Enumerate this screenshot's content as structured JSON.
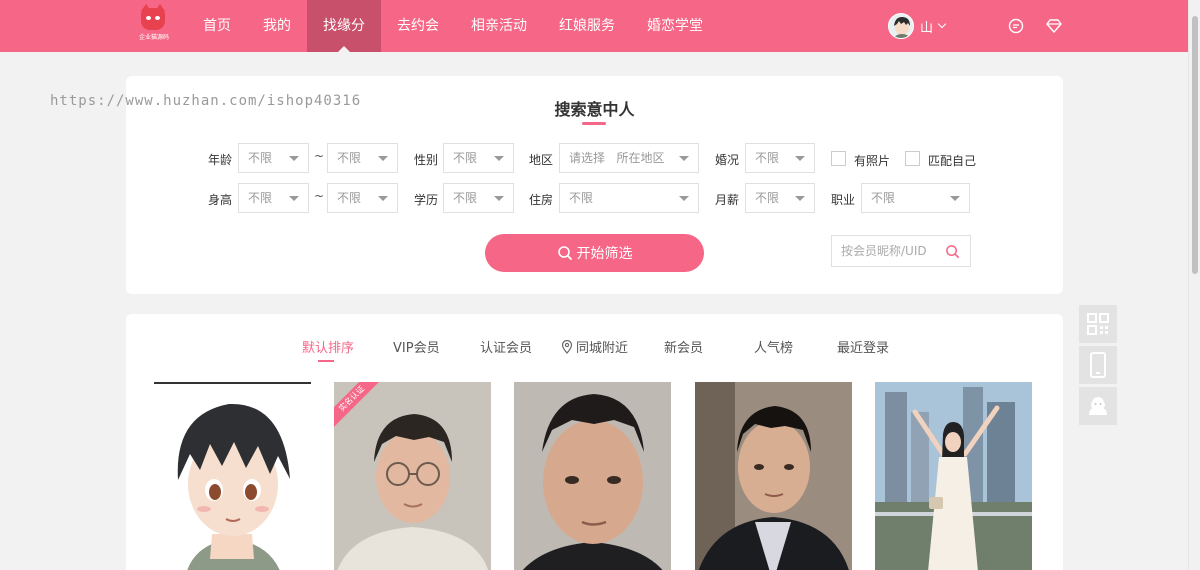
{
  "header": {
    "logo_text": "企业猫源码",
    "nav": [
      {
        "label": "首页"
      },
      {
        "label": "我的"
      },
      {
        "label": "找缘分",
        "active": true
      },
      {
        "label": "去约会"
      },
      {
        "label": "相亲活动"
      },
      {
        "label": "红娘服务"
      },
      {
        "label": "婚恋学堂"
      }
    ],
    "user_name": "山",
    "icons": [
      "chat-icon",
      "diamond-icon"
    ],
    "accent_color": "#f66787"
  },
  "watermark": "https://www.huzhan.com/ishop40316",
  "search": {
    "title": "搜索意中人",
    "row1": {
      "age_label": "年龄",
      "age_from": "不限",
      "tilde": "~",
      "age_to": "不限",
      "gender_label": "性别",
      "gender": "不限",
      "region_label": "地区",
      "region": "请选择   所在地区",
      "marital_label": "婚况",
      "marital": "不限",
      "has_photo_label": "有照片",
      "match_self_label": "匹配自己"
    },
    "row2": {
      "height_label": "身高",
      "height_from": "不限",
      "tilde": "~",
      "height_to": "不限",
      "edu_label": "学历",
      "edu": "不限",
      "housing_label": "住房",
      "housing": "不限",
      "salary_label": "月薪",
      "salary": "不限",
      "job_label": "职业",
      "job": "不限"
    },
    "filter_button": "开始筛选",
    "uid_placeholder": "按会员昵称/UID"
  },
  "list": {
    "tabs": [
      {
        "label": "默认排序",
        "active": true
      },
      {
        "label": "VIP会员"
      },
      {
        "label": "认证会员"
      },
      {
        "label": "同城附近",
        "icon": "location-icon"
      },
      {
        "label": "新会员"
      },
      {
        "label": "人气榜"
      },
      {
        "label": "最近登录"
      }
    ],
    "badge": "实名认证",
    "cards": [
      "anime-avatar",
      "man-glasses",
      "man-closeup",
      "man-jacket",
      "woman-dress"
    ]
  },
  "side_tools": [
    "qrcode-icon",
    "phone-icon",
    "customer-service-icon"
  ]
}
